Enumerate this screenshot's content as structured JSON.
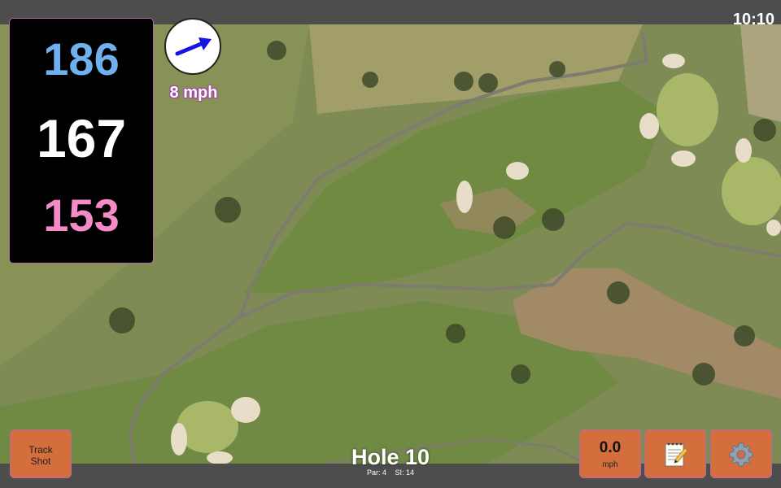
{
  "status_bar": {
    "time": "10:10"
  },
  "distances": {
    "back": "186",
    "middle": "167",
    "front": "153"
  },
  "wind": {
    "speed": "8 mph",
    "icon": "wind-arrow-icon"
  },
  "hole": {
    "title": "Hole 10",
    "par": "Par: 4",
    "stroke_index": "SI: 14"
  },
  "buttons": {
    "track_shot": {
      "line1": "Track",
      "line2": "Shot"
    },
    "speed": {
      "value": "0.0",
      "unit": "mph"
    },
    "notes": {
      "icon": "notepad-icon"
    },
    "settings": {
      "icon": "gear-icon"
    }
  },
  "colors": {
    "back": "#6fb0ef",
    "middle": "#ffffff",
    "front": "#f48ac6",
    "button": "#d46f3d",
    "bar": "#4d4d4d"
  }
}
